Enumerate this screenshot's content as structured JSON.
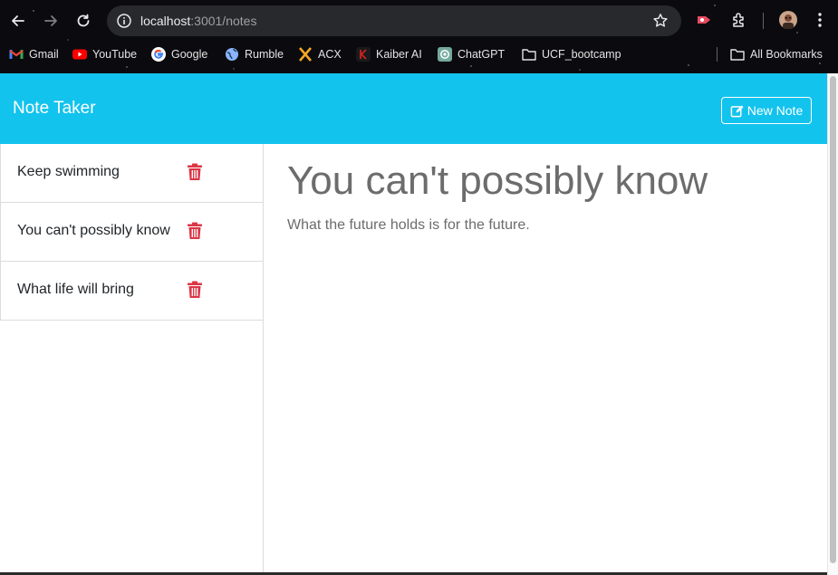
{
  "browser": {
    "url_host": "localhost",
    "url_path": ":3001/notes",
    "bookmarks": [
      {
        "label": "Gmail",
        "icon": "gmail-icon"
      },
      {
        "label": "YouTube",
        "icon": "youtube-icon"
      },
      {
        "label": "Google",
        "icon": "google-icon"
      },
      {
        "label": "Rumble",
        "icon": "globe-icon"
      },
      {
        "label": "ACX",
        "icon": "acx-icon"
      },
      {
        "label": "Kaiber AI",
        "icon": "kaiber-icon"
      },
      {
        "label": "ChatGPT",
        "icon": "chatgpt-icon"
      },
      {
        "label": "UCF_bootcamp",
        "icon": "folder-icon"
      }
    ],
    "all_bookmarks": "All Bookmarks"
  },
  "app": {
    "brand": "Note Taker",
    "new_note_label": "New Note",
    "accent_color": "#12c3ed",
    "delete_color": "#dc3545"
  },
  "notes": [
    {
      "title": "Keep swimming"
    },
    {
      "title": "You can't possibly know"
    },
    {
      "title": "What life will bring"
    }
  ],
  "active_note": {
    "title": "You can't possibly know",
    "text": "What the future holds is for the future."
  }
}
